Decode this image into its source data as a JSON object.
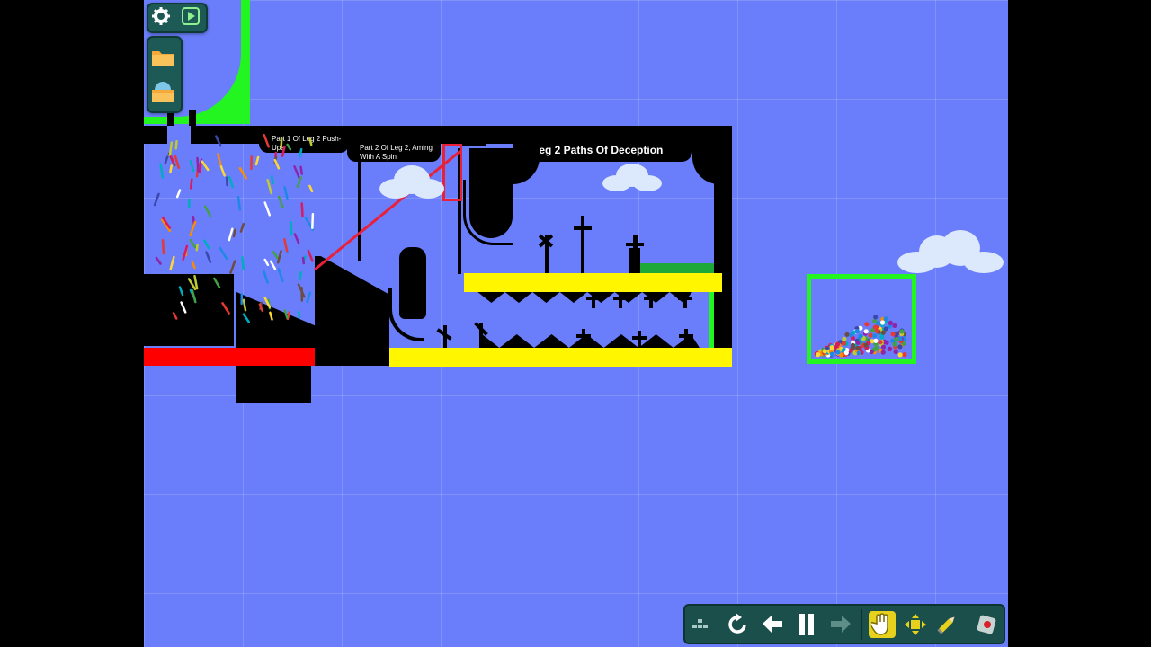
{
  "level": {
    "labels": {
      "part1": "Part 1 Of Leg 2 Push-Ups",
      "part2": "Part 2 Of Leg 2, Aming With A Spin",
      "title": "Leg 2 Paths Of Deception"
    }
  },
  "colors": {
    "background": "#6a7dfa",
    "wall": "#000000",
    "green_bin": "#22f51f",
    "yellow_platform": "#fff600",
    "red_platform": "#ff0000",
    "laser": "#e8203a",
    "toolbar": "#1b4f4b",
    "active_tool": "#e6d21c"
  },
  "menu": {
    "top_buttons": [
      "settings-gear-icon",
      "play-video-icon"
    ],
    "side_buttons": [
      "folder-icon",
      "level-browser-icon"
    ]
  },
  "toolbar": {
    "buttons": [
      "grid-icon",
      "reset-icon",
      "undo-icon",
      "pause-icon",
      "redo-icon",
      "hand-tool-icon",
      "move-tool-icon",
      "pencil-tool-icon",
      "record-icon"
    ],
    "active_tool": "hand-tool-icon"
  }
}
